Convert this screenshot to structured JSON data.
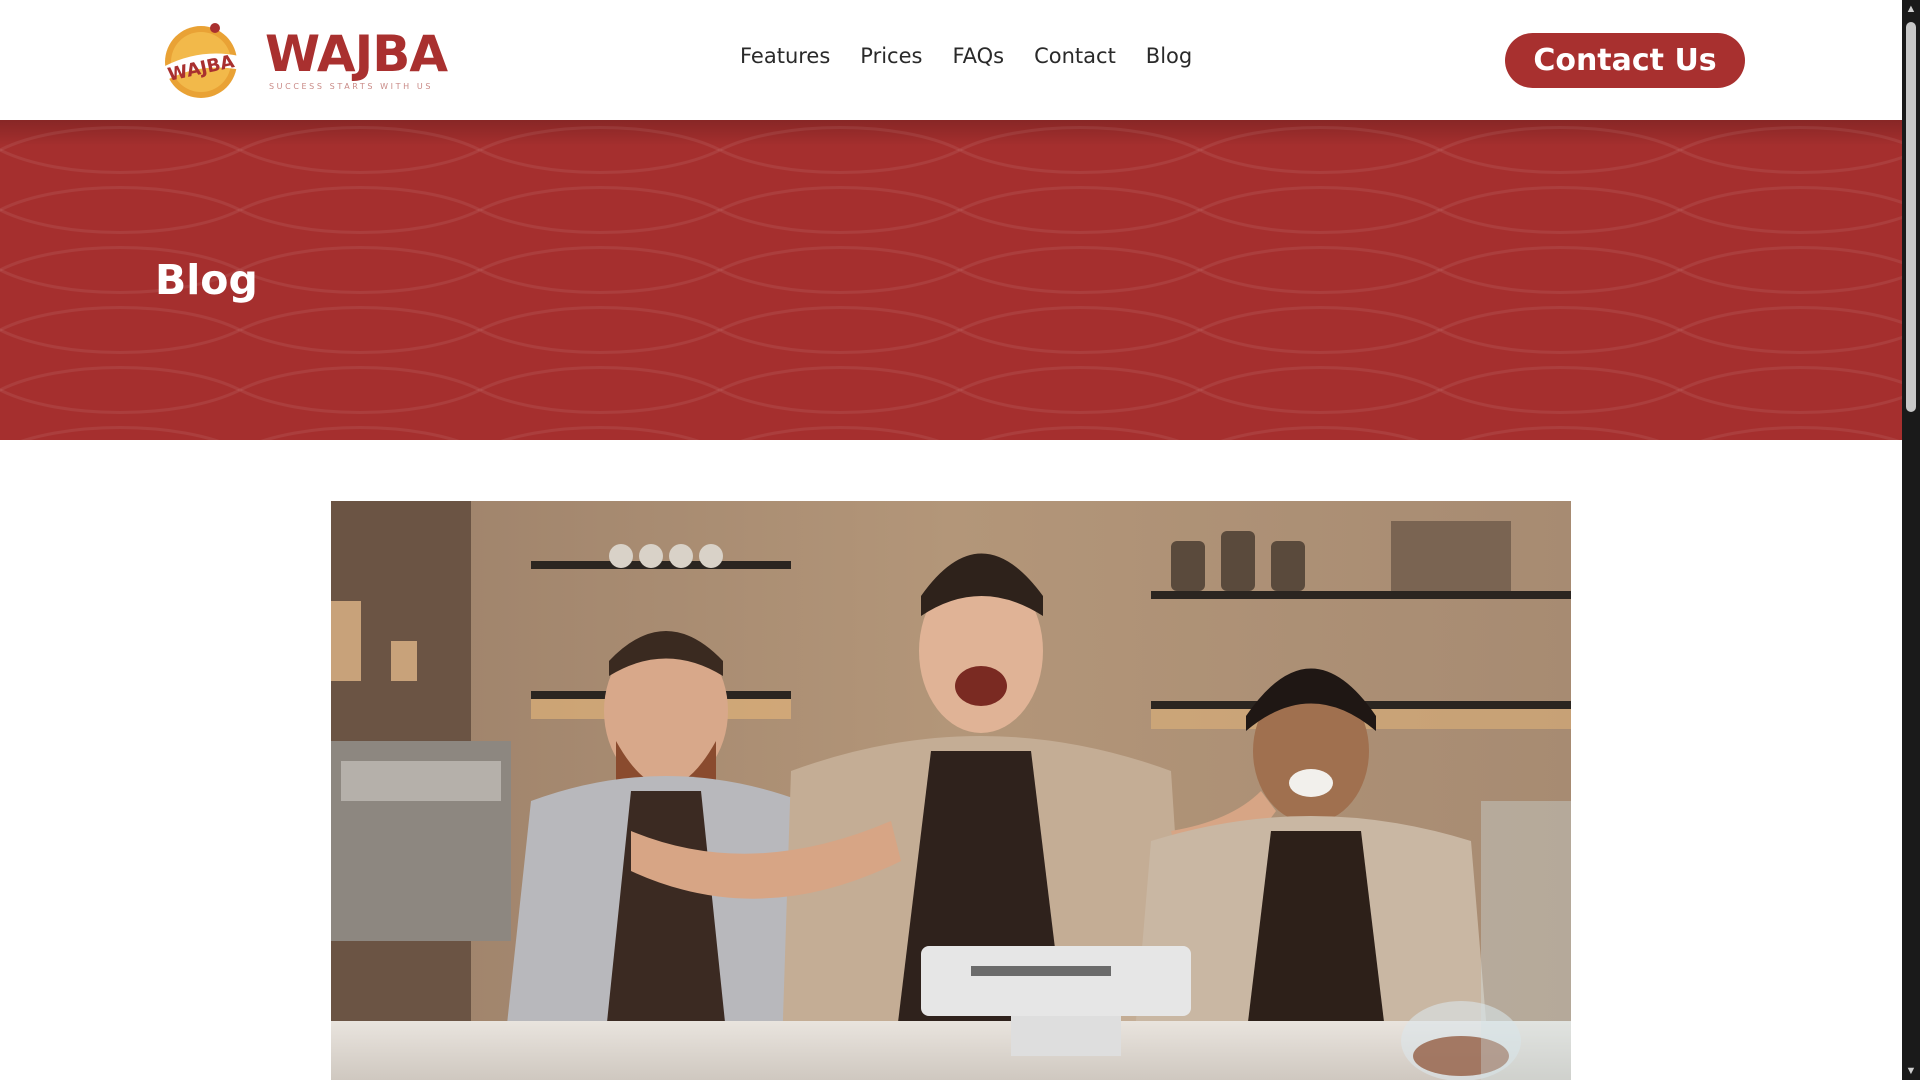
{
  "header": {
    "logo": {
      "badge_text": "WAJBA",
      "wordmark": "WAJBA",
      "tagline": "SUCCESS STARTS WITH US"
    },
    "nav": [
      {
        "label": "Features"
      },
      {
        "label": "Prices"
      },
      {
        "label": "FAQs"
      },
      {
        "label": "Contact"
      },
      {
        "label": "Blog"
      }
    ],
    "cta_label": "Contact Us"
  },
  "hero": {
    "title": "Blog"
  },
  "featured_image": {
    "subject": "three smiling baristas behind a cafe counter"
  },
  "colors": {
    "brand": "#a8302f",
    "hero_bg": "#a52f2e",
    "nav_text": "#2a2a2a"
  },
  "icons": {
    "scroll_up": "triangle-up-icon",
    "scroll_down": "triangle-down-icon"
  }
}
